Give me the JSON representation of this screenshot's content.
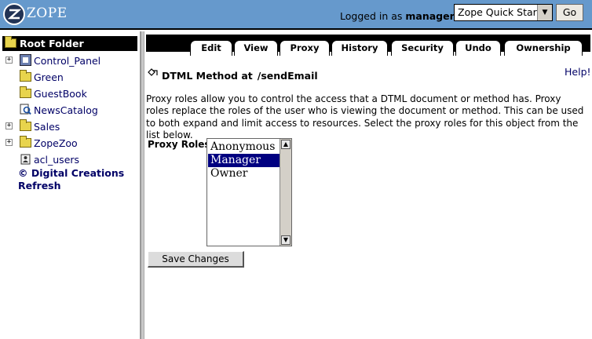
{
  "header": {
    "logo_text": "ZOPE",
    "logged_in_prefix": "Logged in as",
    "logged_in_user": "manager",
    "quick_start_selected": "Zope Quick Start",
    "go_label": "Go"
  },
  "tree": {
    "root_label": "Root Folder",
    "items": [
      {
        "label": "Control_Panel",
        "expandable": true,
        "icon": "control-panel-icon"
      },
      {
        "label": "Green",
        "expandable": false,
        "icon": "folder-icon"
      },
      {
        "label": "GuestBook",
        "expandable": false,
        "icon": "folder-icon"
      },
      {
        "label": "NewsCatalog",
        "expandable": false,
        "icon": "catalog-icon"
      },
      {
        "label": "Sales",
        "expandable": true,
        "icon": "folder-icon"
      },
      {
        "label": "ZopeZoo",
        "expandable": true,
        "icon": "folder-icon"
      },
      {
        "label": "acl_users",
        "expandable": false,
        "icon": "users-icon"
      }
    ],
    "copyright": "© Digital Creations",
    "refresh": "Refresh"
  },
  "tabs": [
    "Edit",
    "View",
    "Proxy",
    "History",
    "Security",
    "Undo",
    "Ownership"
  ],
  "active_tab": "Proxy",
  "main": {
    "object_type": "DTML Method at",
    "object_path": "/sendEmail",
    "help_label": "Help!",
    "description": "Proxy roles allow you to control the access that a DTML document or method has. Proxy roles replace the roles of the user who is viewing the document or method. This can be used to both expand and limit access to resources. Select the proxy roles for this object from the list below.",
    "proxy_roles_label": "Proxy Roles",
    "roles": [
      "Anonymous",
      "Manager",
      "Owner"
    ],
    "selected_role": "Manager",
    "save_label": "Save Changes"
  },
  "colors": {
    "banner": "#6699cc",
    "selection": "#000080",
    "link": "#000066"
  }
}
